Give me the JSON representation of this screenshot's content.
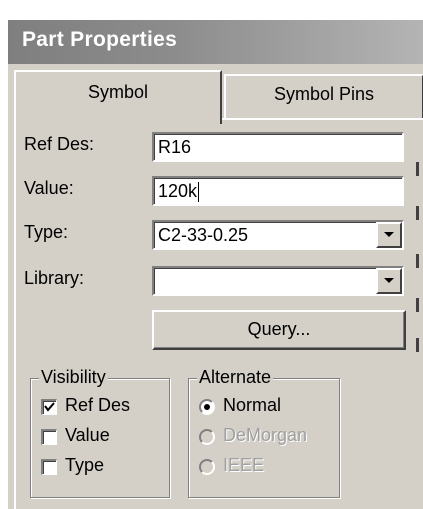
{
  "window": {
    "title": "Part Properties"
  },
  "tabs": [
    {
      "label": "Symbol",
      "active": true
    },
    {
      "label": "Symbol Pins",
      "active": false
    }
  ],
  "fields": {
    "ref_des": {
      "label": "Ref Des:",
      "value": "R16"
    },
    "value": {
      "label": "Value:",
      "value": "120k"
    },
    "type": {
      "label": "Type:",
      "value": "C2-33-0.25"
    },
    "library": {
      "label": "Library:",
      "value": ""
    }
  },
  "query_button": {
    "label": "Query..."
  },
  "visibility": {
    "title": "Visibility",
    "items": [
      {
        "label": "Ref Des",
        "checked": true
      },
      {
        "label": "Value",
        "checked": false
      },
      {
        "label": "Type",
        "checked": false
      }
    ]
  },
  "alternate": {
    "title": "Alternate",
    "options": [
      {
        "label": "Normal",
        "selected": true,
        "enabled": true
      },
      {
        "label": "DeMorgan",
        "selected": false,
        "enabled": false
      },
      {
        "label": "IEEE",
        "selected": false,
        "enabled": false
      }
    ]
  },
  "colors": {
    "dialog_face": "#d4d0c8",
    "titlebar": "#8c8c8c",
    "disabled_text": "#a0a0a0"
  }
}
